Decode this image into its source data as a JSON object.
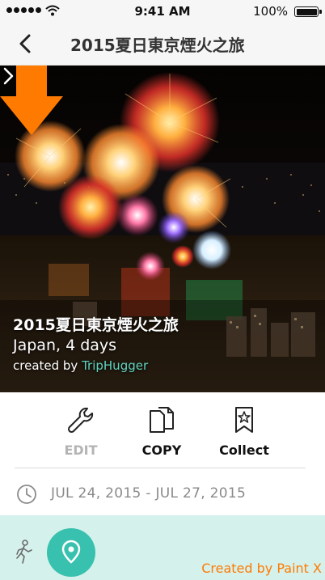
{
  "status_bar": {
    "time": "9:41 AM",
    "battery": "100%",
    "battery_level": 1.0
  },
  "nav": {
    "title": "2015夏日東京煙火之旅"
  },
  "trip": {
    "title": "2015夏日東京煙火之旅",
    "subtitle": "Japan, 4 days",
    "created_by_prefix": "created by",
    "author": "TripHugger"
  },
  "actions": {
    "edit_label": "EDIT",
    "copy_label": "COPY",
    "collect_label": "Collect"
  },
  "dates": {
    "range": "JUL 24, 2015 - JUL 27, 2015"
  },
  "watermark": "Created by Paint X",
  "colors": {
    "accent": "#38c1ae",
    "author": "#5fd3c0",
    "bottom_bar": "#d5f1eb",
    "annotation": "#ff7a00"
  }
}
